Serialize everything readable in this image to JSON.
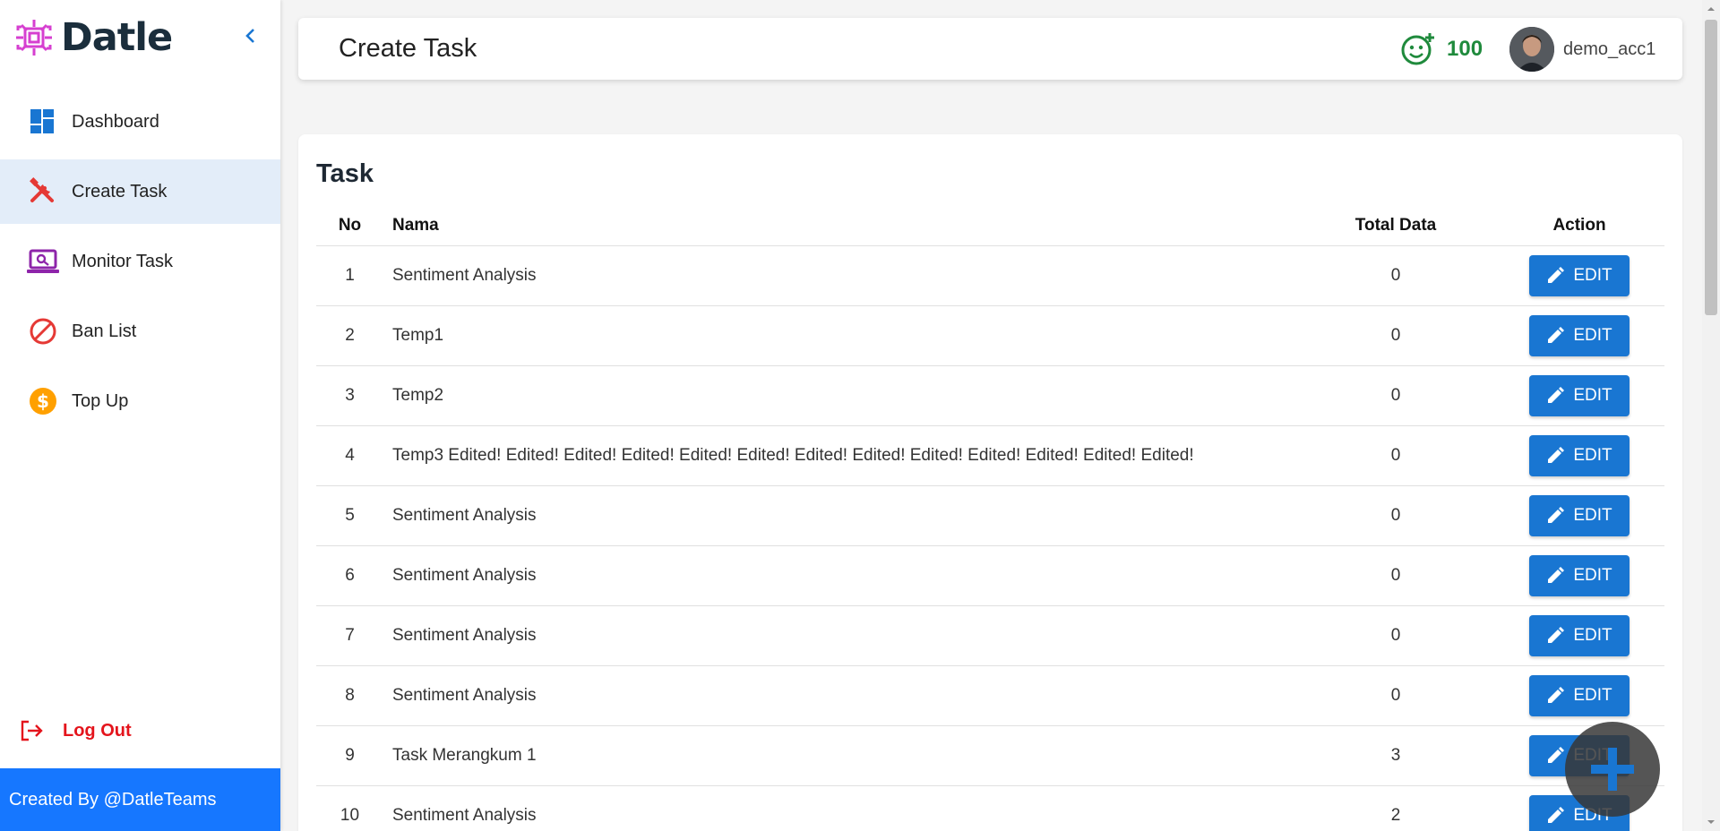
{
  "brand": {
    "name": "Datle"
  },
  "sidebar": {
    "items": [
      {
        "label": "Dashboard",
        "icon": "dashboard-icon",
        "active": false
      },
      {
        "label": "Create Task",
        "icon": "tools-icon",
        "active": true
      },
      {
        "label": "Monitor Task",
        "icon": "monitor-search-icon",
        "active": false
      },
      {
        "label": "Ban List",
        "icon": "ban-icon",
        "active": false
      },
      {
        "label": "Top Up",
        "icon": "dollar-coin-icon",
        "active": false
      }
    ],
    "logout_label": "Log Out",
    "footer": "Created By @DatleTeams"
  },
  "header": {
    "title": "Create Task",
    "points": "100",
    "username": "demo_acc1"
  },
  "card": {
    "title": "Task",
    "columns": {
      "no": "No",
      "name": "Nama",
      "total": "Total Data",
      "action": "Action"
    },
    "edit_label": "EDIT",
    "rows": [
      {
        "no": "1",
        "name": "Sentiment Analysis",
        "total": "0"
      },
      {
        "no": "2",
        "name": "Temp1",
        "total": "0"
      },
      {
        "no": "3",
        "name": "Temp2",
        "total": "0"
      },
      {
        "no": "4",
        "name": "Temp3 Edited! Edited! Edited! Edited! Edited! Edited! Edited! Edited! Edited! Edited! Edited! Edited! Edited!",
        "total": "0"
      },
      {
        "no": "5",
        "name": "Sentiment Analysis",
        "total": "0"
      },
      {
        "no": "6",
        "name": "Sentiment Analysis",
        "total": "0"
      },
      {
        "no": "7",
        "name": "Sentiment Analysis",
        "total": "0"
      },
      {
        "no": "8",
        "name": "Sentiment Analysis",
        "total": "0"
      },
      {
        "no": "9",
        "name": "Task Merangkum 1",
        "total": "3"
      },
      {
        "no": "10",
        "name": "Sentiment Analysis",
        "total": "2"
      }
    ]
  },
  "colors": {
    "accent": "#1976d2",
    "active_nav": "#e3edf9",
    "footer": "#1677ff",
    "logout": "#e4141c",
    "points": "#1f8a3c"
  }
}
